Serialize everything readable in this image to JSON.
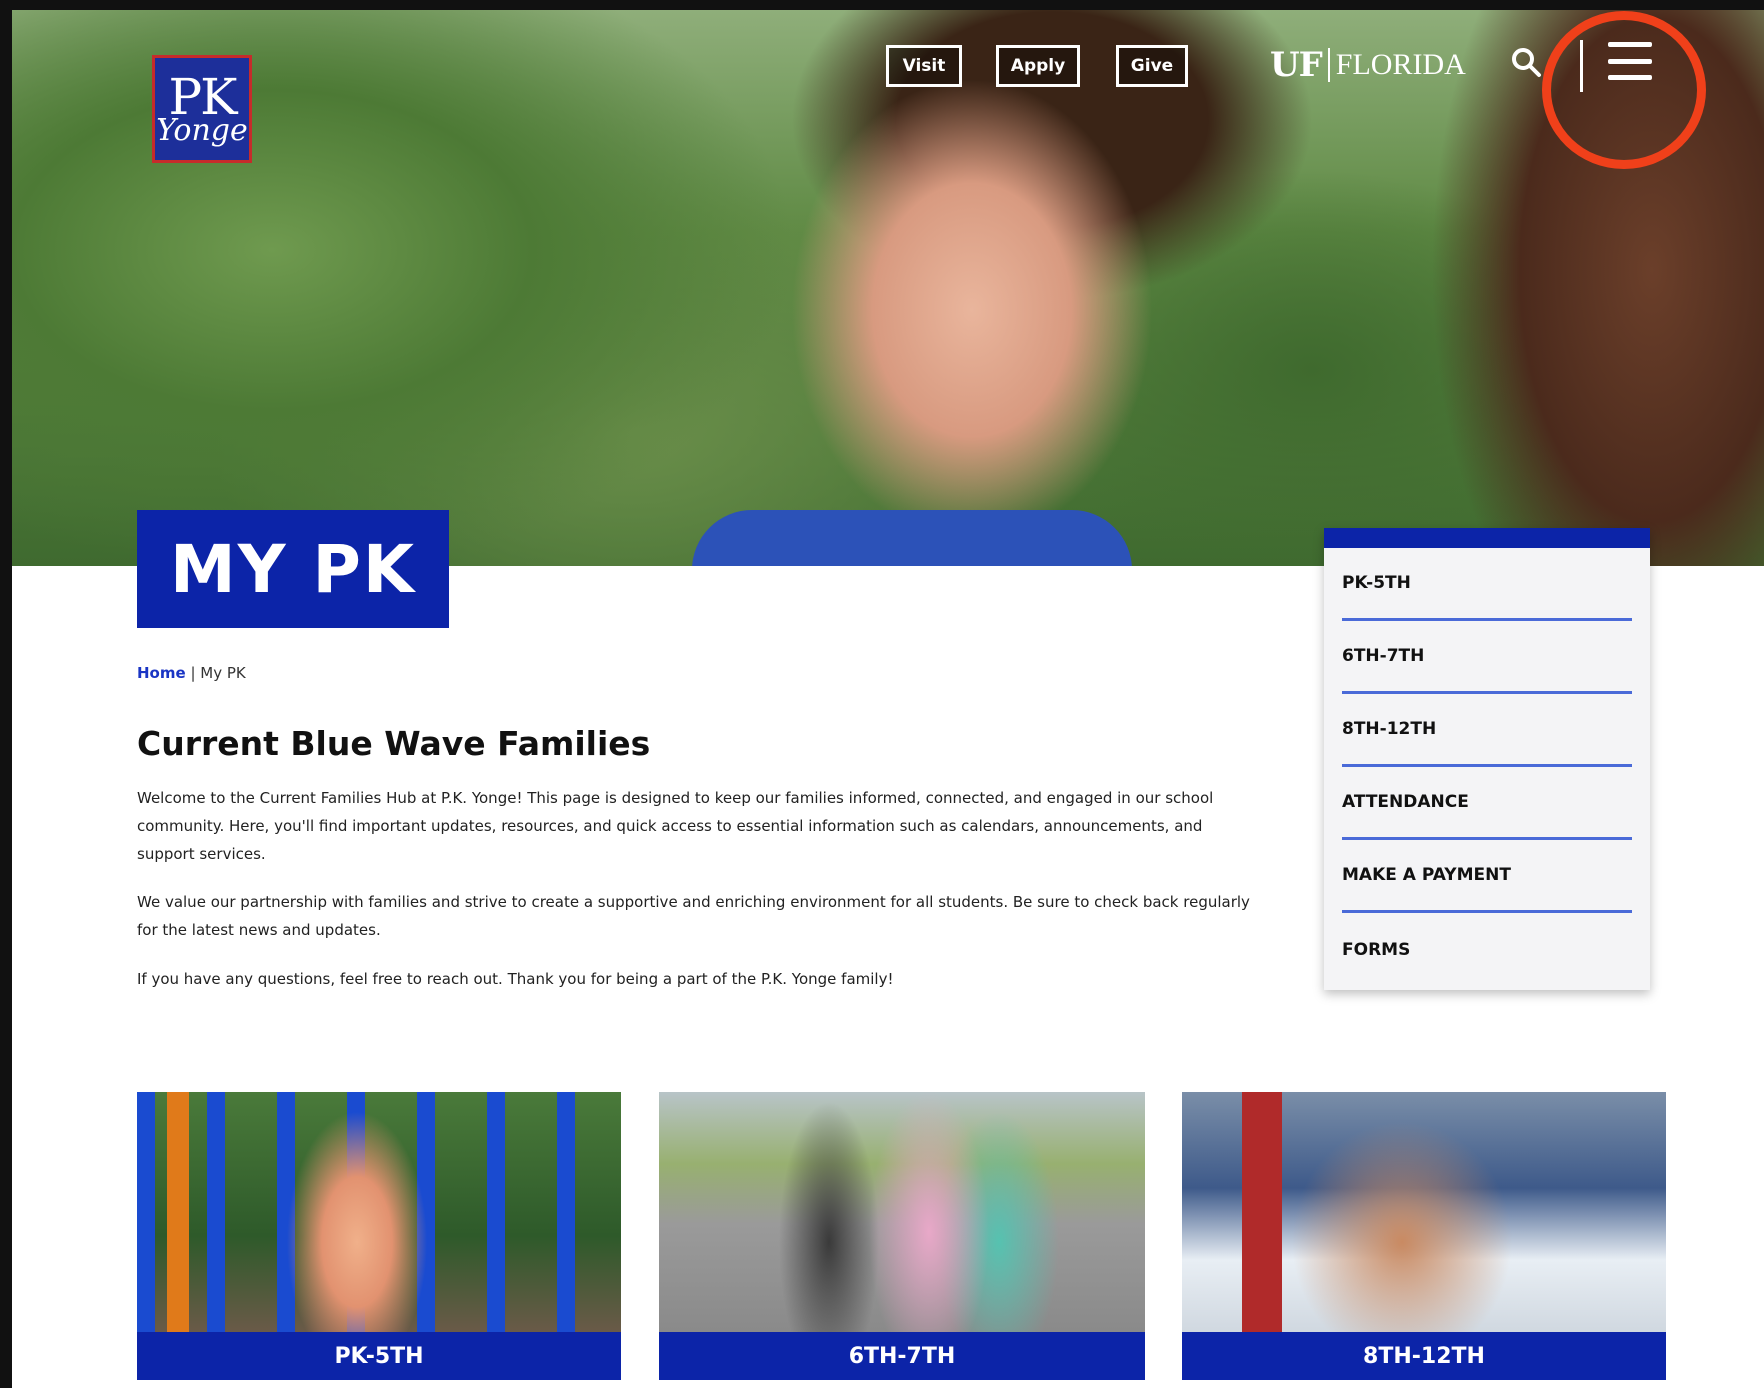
{
  "header": {
    "logo": {
      "line1": "PK",
      "line2": "Yonge"
    },
    "buttons": [
      "Visit",
      "Apply",
      "Give"
    ],
    "uf_logo": {
      "mark": "UF",
      "name": "FLORIDA"
    },
    "icons": {
      "search": "search-icon",
      "menu": "hamburger-menu-icon"
    }
  },
  "hero": {
    "title": "MY PK"
  },
  "breadcrumb": {
    "home": "Home",
    "separator": " | ",
    "current": "My PK"
  },
  "content": {
    "heading": "Current Blue Wave Families",
    "paragraphs": [
      "Welcome to the Current Families Hub at P.K. Yonge! This page is designed to keep our families informed, connected, and engaged in our school community. Here, you'll find important updates, resources, and quick access to essential information such as calendars, announcements, and support services.",
      "We value our partnership with families and strive to create a supportive and enriching environment for all students. Be sure to check back regularly for the latest news and updates.",
      "If you have any questions, feel free to reach out. Thank you for being a part of the P.K. Yonge family!"
    ]
  },
  "side_menu": {
    "items": [
      "PK-5TH",
      "6TH-7TH",
      "8TH-12TH",
      "ATTENDANCE",
      "MAKE A PAYMENT",
      "FORMS"
    ]
  },
  "cards": [
    {
      "label": "PK-5TH"
    },
    {
      "label": "6TH-7TH"
    },
    {
      "label": "8TH-12TH"
    }
  ],
  "colors": {
    "brand_blue": "#0c24a8",
    "link_blue": "#1a35c4",
    "highlight": "#f0401a",
    "divider_blue": "#4a6ad8"
  }
}
